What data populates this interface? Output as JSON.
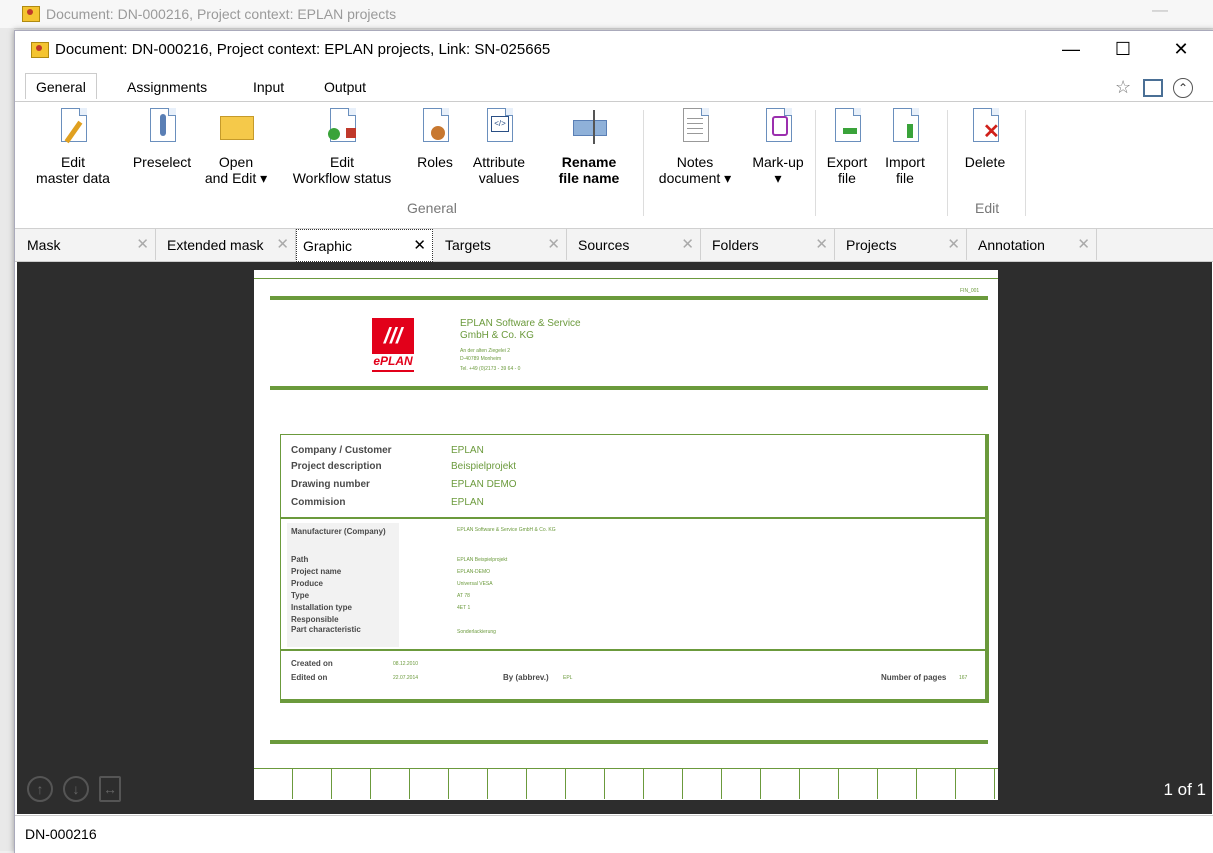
{
  "background_window": {
    "title": "Document: DN-000216, Project context: EPLAN projects"
  },
  "window": {
    "title": "Document: DN-000216, Project context: EPLAN projects, Link: SN-025665",
    "controls": {
      "minimize": "—",
      "maximize": "☐",
      "close": "✕"
    }
  },
  "ribbon_tabs": [
    "General",
    "Assignments",
    "Input",
    "Output"
  ],
  "ribbon": {
    "edit_master_data": [
      "Edit",
      "master data"
    ],
    "preselect": "Preselect",
    "open_and_edit": [
      "Open",
      "and Edit ▾"
    ],
    "edit_workflow": [
      "Edit",
      "Workflow status"
    ],
    "roles": "Roles",
    "attribute_values": [
      "Attribute",
      "values"
    ],
    "rename_file_name": [
      "Rename",
      "file name"
    ],
    "notes_document": [
      "Notes",
      "document ▾"
    ],
    "mark_up": [
      "Mark-up",
      "▾"
    ],
    "export_file": [
      "Export",
      "file"
    ],
    "import_file": [
      "Import",
      "file"
    ],
    "delete": "Delete",
    "group_general": "General",
    "group_edit": "Edit"
  },
  "doc_tabs": [
    "Mask",
    "Extended mask",
    "Graphic",
    "Targets",
    "Sources",
    "Folders",
    "Projects",
    "Annotation"
  ],
  "active_doc_tab": "Graphic",
  "preview": {
    "page_code": "FIN_001",
    "company_lines": [
      "EPLAN Software & Service",
      "GmbH & Co. KG"
    ],
    "address_lines": [
      "An der alten Ziegelei 2",
      "D-40789   Monheim",
      "Tel.      +49 (0)2173 - 39 64 - 0"
    ],
    "logo_text": "ePLAN",
    "header_fields": [
      {
        "label": "Company / Customer",
        "value": "EPLAN"
      },
      {
        "label": "Project description",
        "value": "Beispielprojekt"
      },
      {
        "label": "Drawing number",
        "value": "EPLAN DEMO"
      },
      {
        "label": "Commision",
        "value": "EPLAN"
      }
    ],
    "detail_fields": [
      {
        "label": "Manufacturer (Company)",
        "value": "EPLAN Software & Service GmbH & Co. KG"
      },
      {
        "label": "Path",
        "value": "EPLAN Beispielprojekt"
      },
      {
        "label": "Project name",
        "value": "EPLAN-DEMO"
      },
      {
        "label": "Produce",
        "value": "Universal VESA"
      },
      {
        "label": "Type",
        "value": "AT 78"
      },
      {
        "label": "Installation type",
        "value": "4ET 1"
      },
      {
        "label": "Responsible",
        "value": ""
      },
      {
        "label": "Part characteristic",
        "value": "Sonderlackierung"
      }
    ],
    "created_label": "Created on",
    "created_value": "08.12.2010",
    "edited_label": "Edited on",
    "edited_value": "22.07.2014",
    "by_label": "By (abbrev.)",
    "by_value": "EPL",
    "pages_label": "Number of pages",
    "pages_value": "167"
  },
  "viewer": {
    "page_count": "1 of 1"
  },
  "status": {
    "doc_id": "DN-000216"
  }
}
